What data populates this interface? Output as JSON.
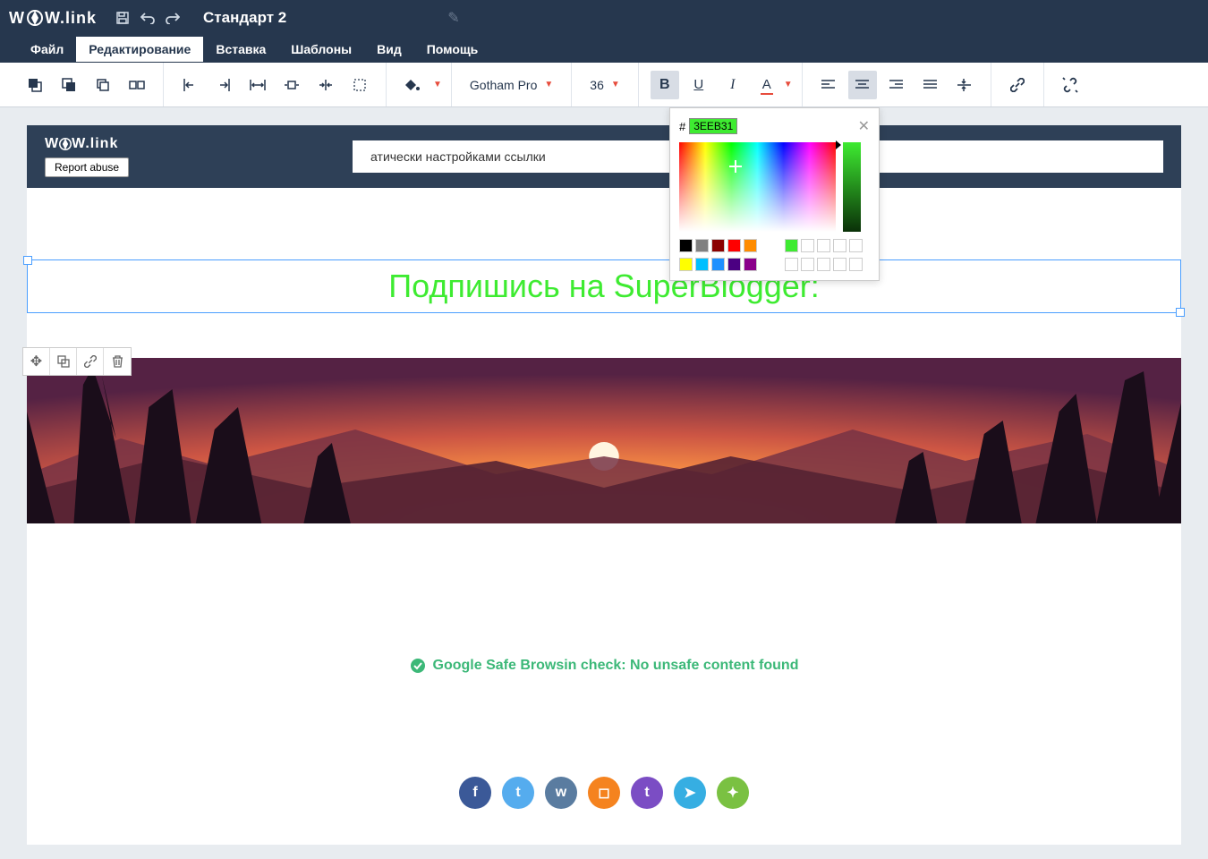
{
  "app": {
    "logo_text": "W W.link",
    "doc_title": "Стандарт 2"
  },
  "menu": {
    "file": "Файл",
    "edit": "Редактирование",
    "insert": "Вставка",
    "templates": "Шаблоны",
    "view": "Вид",
    "help": "Помощь"
  },
  "toolbar": {
    "font": "Gotham Pro",
    "size": "36"
  },
  "color_picker": {
    "hex": "3EEB31",
    "swatches_row1": [
      "#000000",
      "#808080",
      "#8b0000",
      "#ff0000",
      "#ff8c00"
    ],
    "swatch_green": "#3eeb31",
    "swatches_row2": [
      "#ffff00",
      "#00bfff",
      "#1e90ff",
      "#4b0082",
      "#8b008b"
    ]
  },
  "page": {
    "mini_logo": "W W.link",
    "report_abuse": "Report abuse",
    "notice": "атически настройками ссылки",
    "headline": "Подпишись на SuperBlogger:",
    "safe_check": "Google Safe Browsin check: No unsafe content found"
  },
  "socials": [
    {
      "name": "facebook",
      "bg": "#3b5998",
      "glyph": "f"
    },
    {
      "name": "twitter",
      "bg": "#55acee",
      "glyph": "t"
    },
    {
      "name": "vk",
      "bg": "#5a7ca0",
      "glyph": "w"
    },
    {
      "name": "instagram",
      "bg": "#f5831f",
      "glyph": "◻"
    },
    {
      "name": "tumblr",
      "bg": "#7b4dc4",
      "glyph": "t"
    },
    {
      "name": "telegram",
      "bg": "#36aee2",
      "glyph": "➤"
    },
    {
      "name": "evernote",
      "bg": "#7ac142",
      "glyph": "✦"
    }
  ]
}
